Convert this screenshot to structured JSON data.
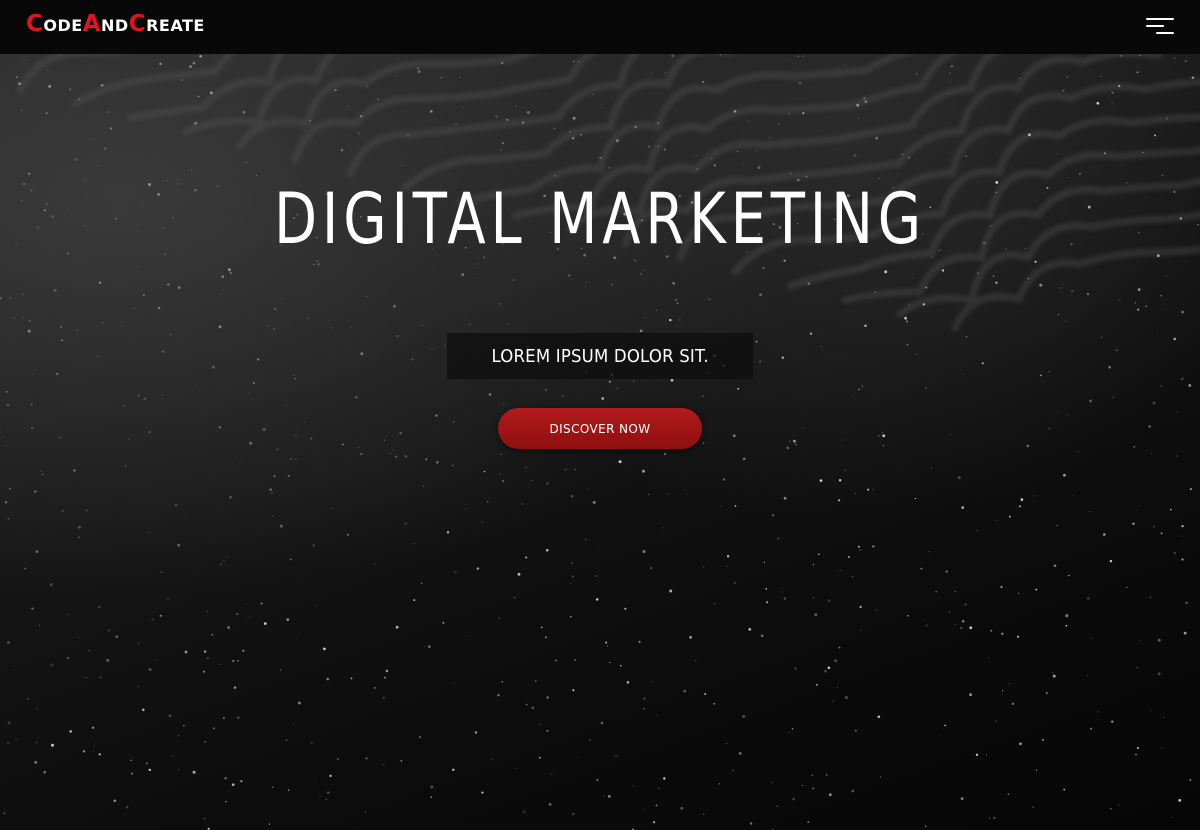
{
  "brand": {
    "logo_parts": [
      {
        "cap": "C",
        "rest": "ode"
      },
      {
        "cap": "A",
        "rest": "nd"
      },
      {
        "cap": "C",
        "rest": "reate"
      }
    ],
    "accent_color": "#e0141e"
  },
  "nav": {
    "menu_icon": "hamburger-menu-icon"
  },
  "hero": {
    "title": "DIGITAL MARKETING",
    "subtitle": "LOREM IPSUM DOLOR SIT.",
    "cta_label": "DISCOVER NOW",
    "cta_color": "#a01415",
    "background_description_color": "#0b0b0b"
  }
}
